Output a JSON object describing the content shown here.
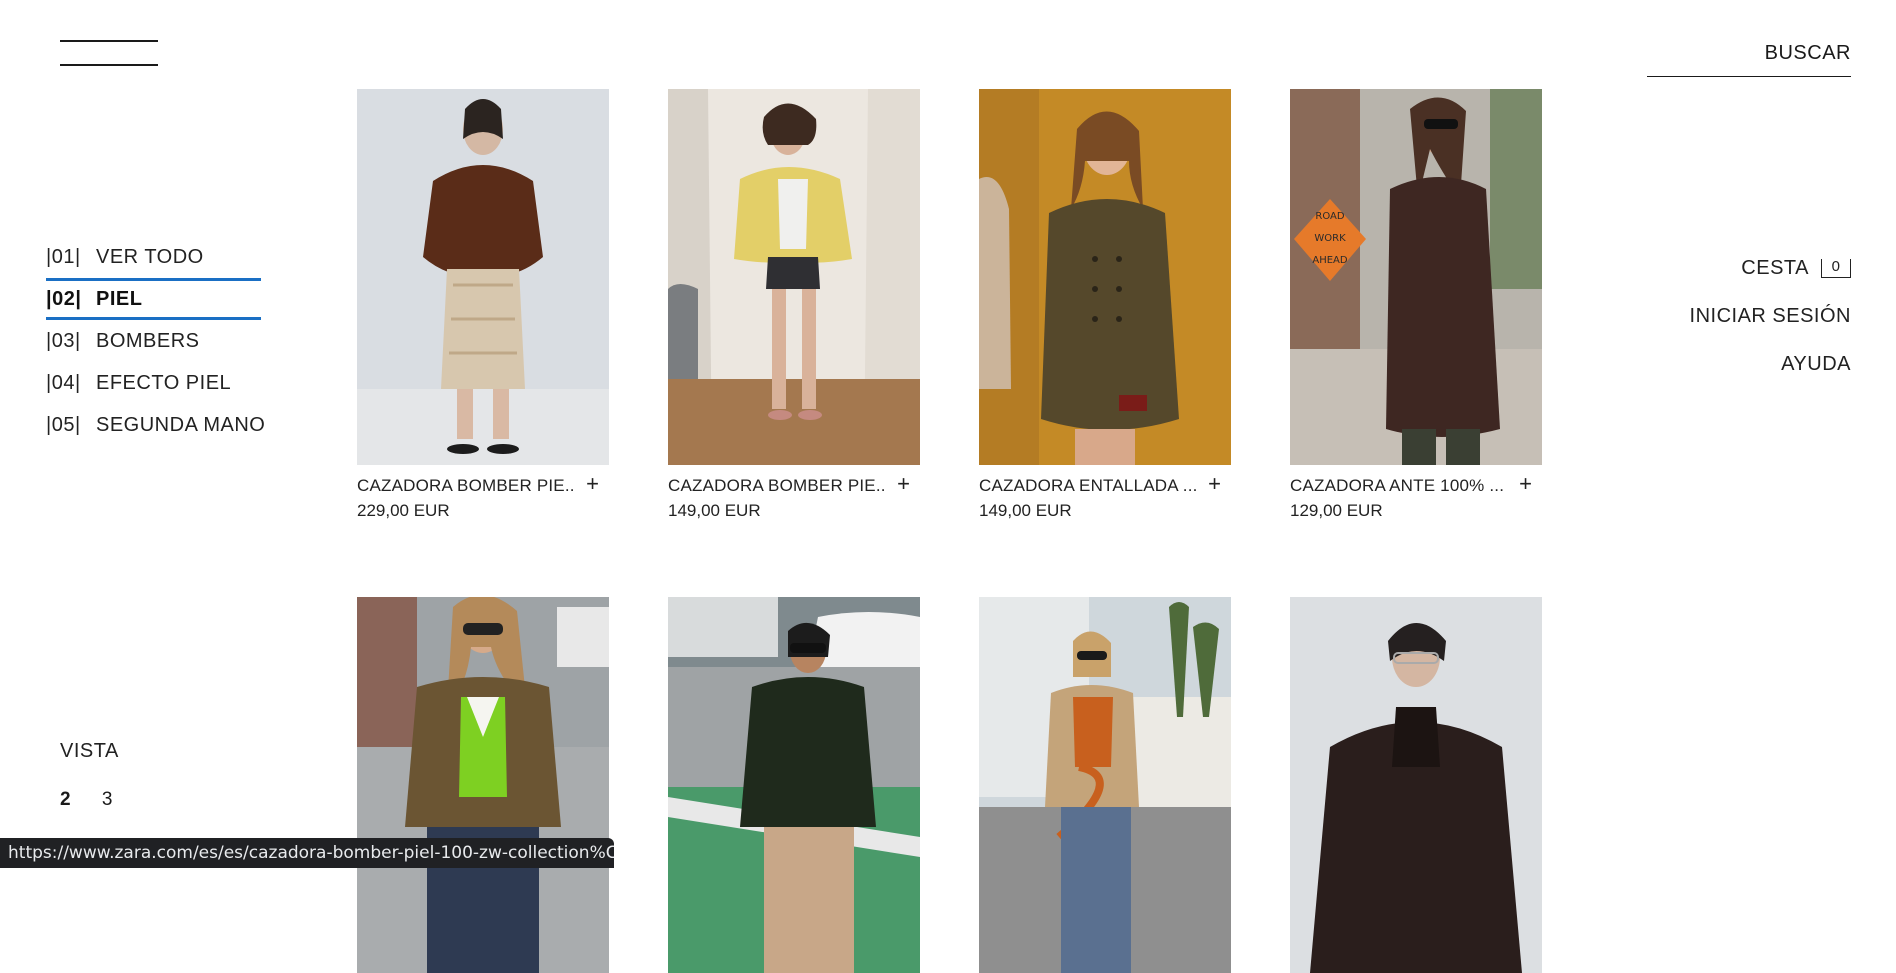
{
  "header": {
    "search_label": "BUSCAR"
  },
  "categories": [
    {
      "num": "|01|",
      "label": "VER TODO"
    },
    {
      "num": "|02|",
      "label": "PIEL"
    },
    {
      "num": "|03|",
      "label": "BOMBERS"
    },
    {
      "num": "|04|",
      "label": "EFECTO PIEL"
    },
    {
      "num": "|05|",
      "label": "SEGUNDA MANO"
    }
  ],
  "right_nav": {
    "cart_label": "CESTA",
    "cart_count": "0",
    "login_label": "INICIAR SESIÓN",
    "help_label": "AYUDA"
  },
  "products": [
    {
      "name": "CAZADORA BOMBER PIE...",
      "price": "229,00 EUR"
    },
    {
      "name": "CAZADORA BOMBER PIE...",
      "price": "149,00 EUR"
    },
    {
      "name": "CAZADORA ENTALLADA ...",
      "price": "149,00 EUR"
    },
    {
      "name": "CAZADORA ANTE 100% ...",
      "price": "129,00 EUR"
    }
  ],
  "view": {
    "label": "VISTA",
    "options": [
      "2",
      "3"
    ],
    "selected": "2"
  },
  "status_url": "https://www.zara.com/es/es/cazadora-bomber-piel-100-zw-collection%C...",
  "colors": {
    "accent": "#1a6fc4",
    "text": "#1a1a1a",
    "status_bar": "#202124"
  }
}
